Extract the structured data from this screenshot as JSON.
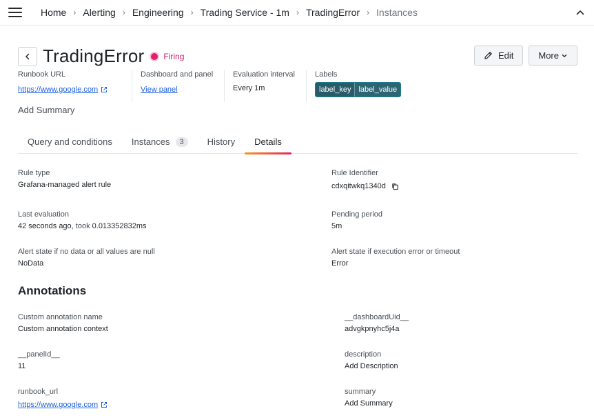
{
  "breadcrumb": {
    "items": [
      "Home",
      "Alerting",
      "Engineering",
      "Trading Service - 1m",
      "TradingError"
    ],
    "current": "Instances"
  },
  "rule": {
    "title": "TradingError",
    "state": "Firing",
    "state_color": "#e0226e"
  },
  "actions": {
    "edit_label": "Edit",
    "more_label": "More"
  },
  "meta": {
    "runbook_label": "Runbook URL",
    "runbook_url": "https://www.google.com",
    "dashboard_label": "Dashboard and panel",
    "dashboard_link": "View panel",
    "interval_label": "Evaluation interval",
    "interval_value": "Every 1m",
    "labels_label": "Labels",
    "label_key": "label_key",
    "label_value": "label_value"
  },
  "add_summary": "Add Summary",
  "tabs": [
    {
      "label": "Query and conditions"
    },
    {
      "label": "Instances",
      "count": "3"
    },
    {
      "label": "History"
    },
    {
      "label": "Details",
      "active": true
    }
  ],
  "details": {
    "rule_type_label": "Rule type",
    "rule_type_value": "Grafana-managed alert rule",
    "rule_id_label": "Rule Identifier",
    "rule_id_value": "cdxqitwkq1340d",
    "last_eval_label": "Last evaluation",
    "last_eval_ago": "42 seconds ago",
    "last_eval_took_word": ", took ",
    "last_eval_duration": "0.013352832ms",
    "pending_label": "Pending period",
    "pending_value": "5m",
    "nodata_label": "Alert state if no data or all values are null",
    "nodata_value": "NoData",
    "error_label": "Alert state if execution error or timeout",
    "error_value": "Error"
  },
  "annotations": {
    "title": "Annotations",
    "custom_name_label": "Custom annotation name",
    "custom_name_value": "Custom annotation context",
    "dashboard_uid_label": "__dashboardUid__",
    "dashboard_uid_value": "advgkpnyhc5j4a",
    "panel_id_label": "__panelId__",
    "panel_id_value": "11",
    "description_label": "description",
    "description_value": "Add Description",
    "runbook_label": "runbook_url",
    "runbook_value": "https://www.google.com",
    "summary_label": "summary",
    "summary_value": "Add Summary"
  },
  "icons": {
    "menu": "hamburger-menu-icon",
    "collapse": "chevron-up-icon",
    "back": "chevron-left-icon",
    "edit": "pencil-icon",
    "more": "chevron-down-icon",
    "external": "external-link-icon",
    "copy": "copy-icon"
  }
}
